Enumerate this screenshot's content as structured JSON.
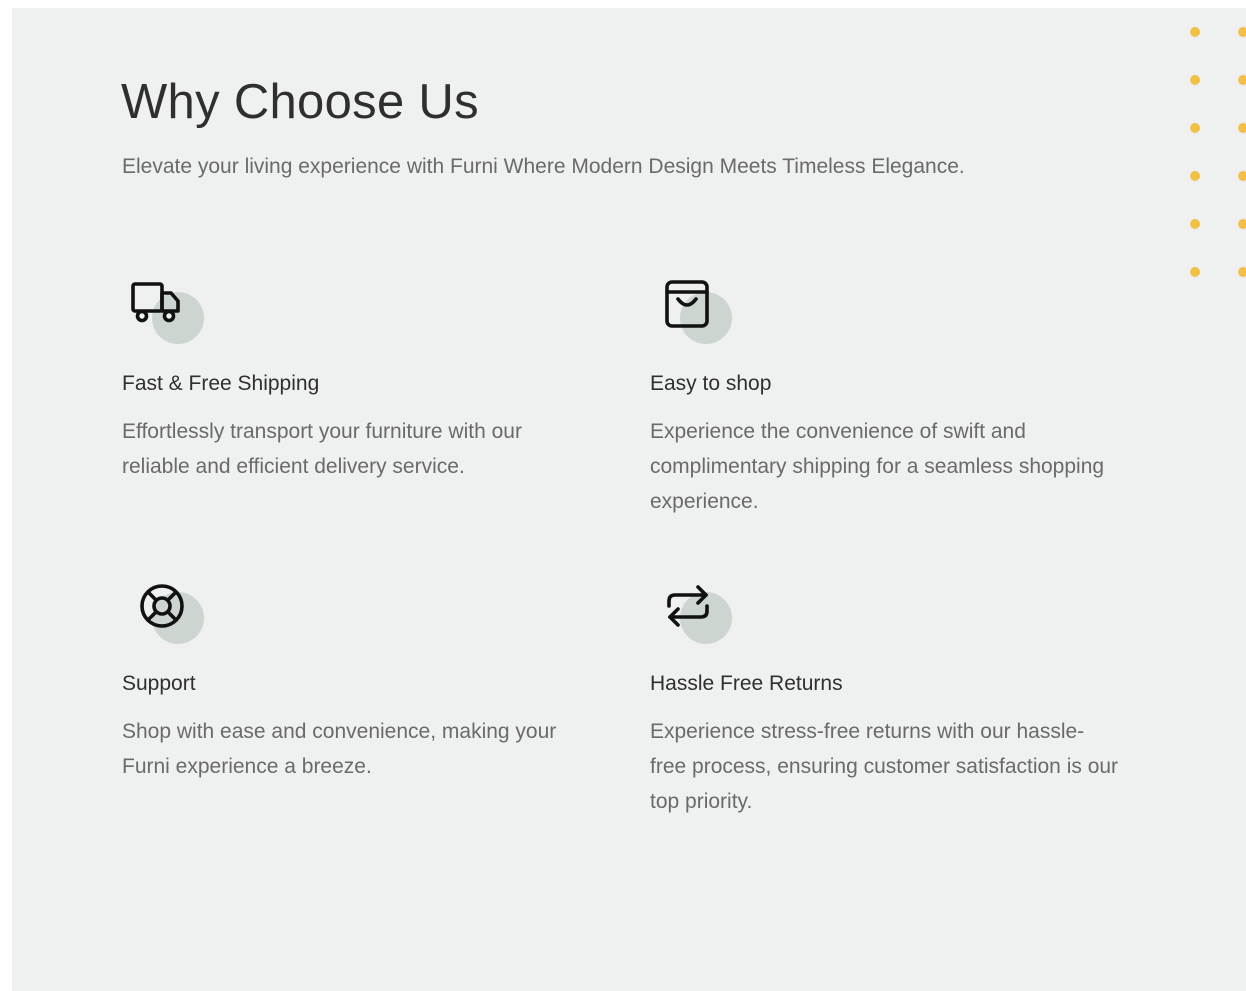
{
  "section": {
    "title": "Why Choose Us",
    "subtitle": "Elevate your living experience with Furni Where Modern Design Meets Timeless Elegance."
  },
  "features": [
    {
      "icon": "truck-icon",
      "title": "Fast & Free Shipping",
      "description": "Effortlessly transport your furniture with our reliable and efficient delivery service."
    },
    {
      "icon": "shopping-bag-icon",
      "title": "Easy to shop",
      "description": "Experience the convenience of swift and complimentary shipping for a seamless shopping experience."
    },
    {
      "icon": "lifebuoy-icon",
      "title": "Support",
      "description": "Shop with ease and convenience, making your Furni experience a breeze."
    },
    {
      "icon": "return-arrows-icon",
      "title": "Hassle Free Returns",
      "description": "Experience stress-free returns with our hassle-free process, ensuring customer satisfaction is our top priority."
    }
  ],
  "colors": {
    "background": "#eff1f0",
    "heading": "#2f2f2f",
    "body_text": "#6a6a6a",
    "icon_circle": "#cdd5d1",
    "dot_accent": "#f0c146"
  }
}
